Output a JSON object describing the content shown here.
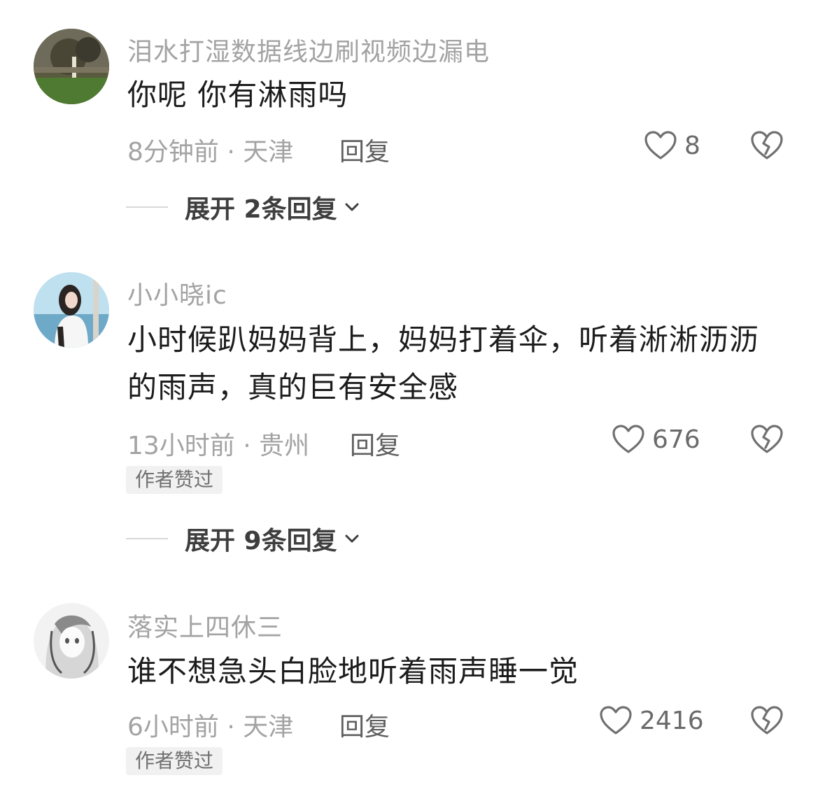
{
  "comments": [
    {
      "username": "泪水打湿数据线边刷视频边漏电",
      "content": "你呢 你有淋雨吗",
      "time": "8分钟前",
      "location": "天津",
      "meta": "8分钟前 · 天津",
      "reply_label": "回复",
      "likes": "8",
      "badge": null,
      "expand_label": "展开 2条回复"
    },
    {
      "username": "小小晓ic",
      "content": "小时候趴妈妈背上，妈妈打着伞，听着淅淅沥沥的雨声，真的巨有安全感",
      "time": "13小时前",
      "location": "贵州",
      "meta": "13小时前 · 贵州",
      "reply_label": "回复",
      "likes": "676",
      "badge": "作者赞过",
      "expand_label": "展开 9条回复"
    },
    {
      "username": "落实上四休三",
      "content": "谁不想急头白脸地听着雨声睡一觉",
      "time": "6小时前",
      "location": "天津",
      "meta": "6小时前 · 天津",
      "reply_label": "回复",
      "likes": "2416",
      "badge": "作者赞过",
      "expand_label": null
    }
  ],
  "icons": {
    "like": "heart-outline-icon",
    "dislike": "broken-heart-icon",
    "expand": "chevron-down-icon"
  },
  "colors": {
    "username": "#a3a3a3",
    "content": "#1c1c1c",
    "meta": "#a3a3a3",
    "badge_bg": "#f1f1f1"
  }
}
